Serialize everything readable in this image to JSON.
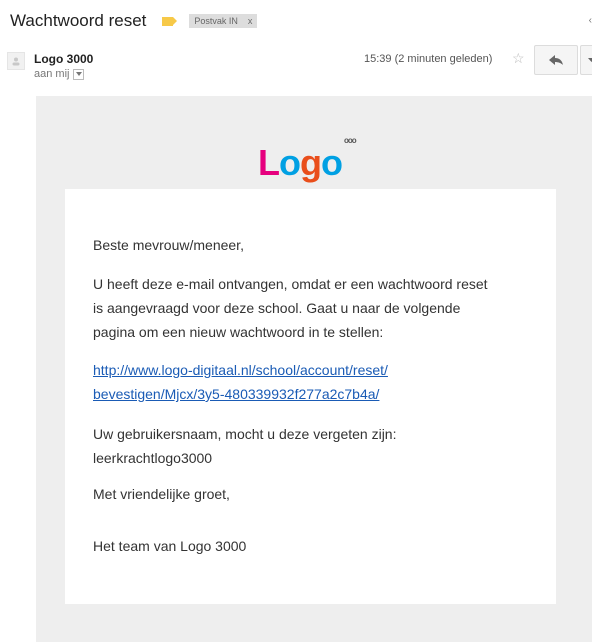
{
  "header": {
    "subject": "Wachtwoord reset",
    "label": "Postvak IN",
    "label_remove": "x",
    "label_color": "#f7c948"
  },
  "message": {
    "sender": "Logo 3000",
    "to": "aan mij",
    "time": "15:39 (2 minuten geleden)"
  },
  "body": {
    "logo": {
      "letters": [
        "L",
        "o",
        "g",
        "o"
      ],
      "suffix": "ooo",
      "colors": [
        "#e6007e",
        "#00a0e3",
        "#e94e1b",
        "#00a0e3"
      ]
    },
    "greeting": "Beste mevrouw/meneer,",
    "intro_line1": "U heeft deze e-mail ontvangen, omdat er een wachtwoord reset",
    "intro_line2": "is aangevraagd voor deze school. Gaat u naar de volgende",
    "intro_line3": "pagina om een nieuw wachtwoord in te stellen:",
    "link_line1": "http://www.logo-digitaal.nl/school/account/reset/",
    "link_line2": "bevestigen/Mjcx/3y5-480339932f277a2c7b4a/",
    "username_text": "Uw gebruikersnaam, mocht u deze vergeten zijn:",
    "username": "leerkrachtlogo3000",
    "regards": "Met vriendelijke groet,",
    "signature": "Het team van Logo 3000"
  }
}
